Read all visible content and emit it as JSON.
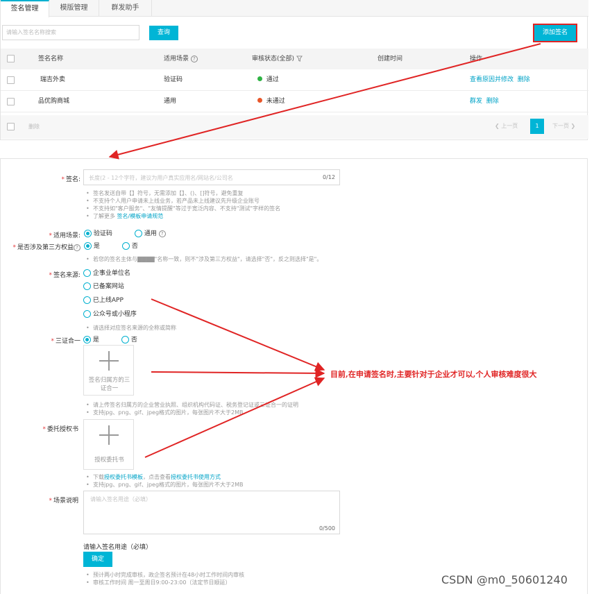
{
  "tabs": [
    "签名管理",
    "模版管理",
    "群发助手"
  ],
  "search": {
    "placeholder": "请输入签名名称搜索",
    "button": "查询"
  },
  "add_button": "添加签名",
  "table": {
    "headers": [
      "签名名称",
      "适用场景",
      "审核状态(全部)",
      "创建时间",
      "操作"
    ],
    "rows": [
      {
        "name": "瑞吉外卖",
        "scene": "验证码",
        "status": "通过",
        "status_color": "#2fb344",
        "actions": [
          "查看原因并修改",
          "删除"
        ]
      },
      {
        "name": "品优购商城",
        "scene": "通用",
        "status": "未通过",
        "status_color": "#e8572a",
        "actions": [
          "群发",
          "删除"
        ]
      }
    ],
    "bulk_delete": "删除",
    "pager": {
      "prev": "上一页",
      "page": "1",
      "next": "下一页"
    }
  },
  "form": {
    "sign_label": "签名:",
    "sign_placeholder": "长度(2 - 12个字符，建议为用户真实应用名/网站名/公司名",
    "sign_count": "0/12",
    "sign_hints": [
      "签名发送自带【】符号，无需添加【】、()、[]符号，避免重复",
      "不支持个人用户申请未上线业务，若产品未上线建议先升级企业账号",
      "不支持如\"客户服务\"、\"友情提醒\"等过于宽泛内容、不支持\"测试\"字样的签名",
      "了解更多"
    ],
    "sign_hint_link": "签名/模板申请规范",
    "scene_label": "适用场景:",
    "scene_options": [
      "验证码",
      "通用"
    ],
    "third_party_label": "是否涉及第三方权益",
    "yes": "是",
    "no": "否",
    "third_party_hint": "若您的签名主体与▇▇▇▇\"名称一致，则不\"涉及第三方权益\"，请选择\"否\"，反之则选择\"是\"。",
    "source_label": "签名来源:",
    "source_options": [
      "企事业单位名",
      "已备案网站",
      "已上线APP",
      "公众号或小程序"
    ],
    "source_hint": "请选择对应签名来源的全称或简称",
    "cert_label": "三证合一",
    "cert_upload_text": "签名归属方的三证合一",
    "cert_hints": [
      "请上传签名归属方的企业营业执照、组织机构代码证、税务登记证或三证合一的证明",
      "支持jpg、png、gif、jpeg格式的图片，每张图片不大于2MB"
    ],
    "auth_label": "委托授权书",
    "auth_upload_text": "授权委托书",
    "auth_hint_pre": "下载",
    "auth_hint_link1": "授权委托书模板",
    "auth_hint_mid": "，点击查看",
    "auth_hint_link2": "授权委托书使用方式",
    "auth_hint_2": "支持jpg、png、gif、jpeg格式的图片，每张图片不大于2MB",
    "desc_label": "场景说明",
    "desc_placeholder": "请输入签名用途（必填）",
    "desc_count": "0/500",
    "desc_error": "请输入签名用途（必填）",
    "confirm": "确定",
    "footer_hints": [
      "预计两小时完成审核，政企签名预计在48小时工作时间内审核",
      "审核工作时间 周一至周日9:00-23:00（法定节日顺延）"
    ]
  },
  "annotation": "目前,在申请签名时,主要针对于企业才可以,个人审核难度很大",
  "watermark": "CSDN @m0_50601240",
  "colors": {
    "accent": "#00b5d6",
    "annotation_red": "#e02424"
  }
}
